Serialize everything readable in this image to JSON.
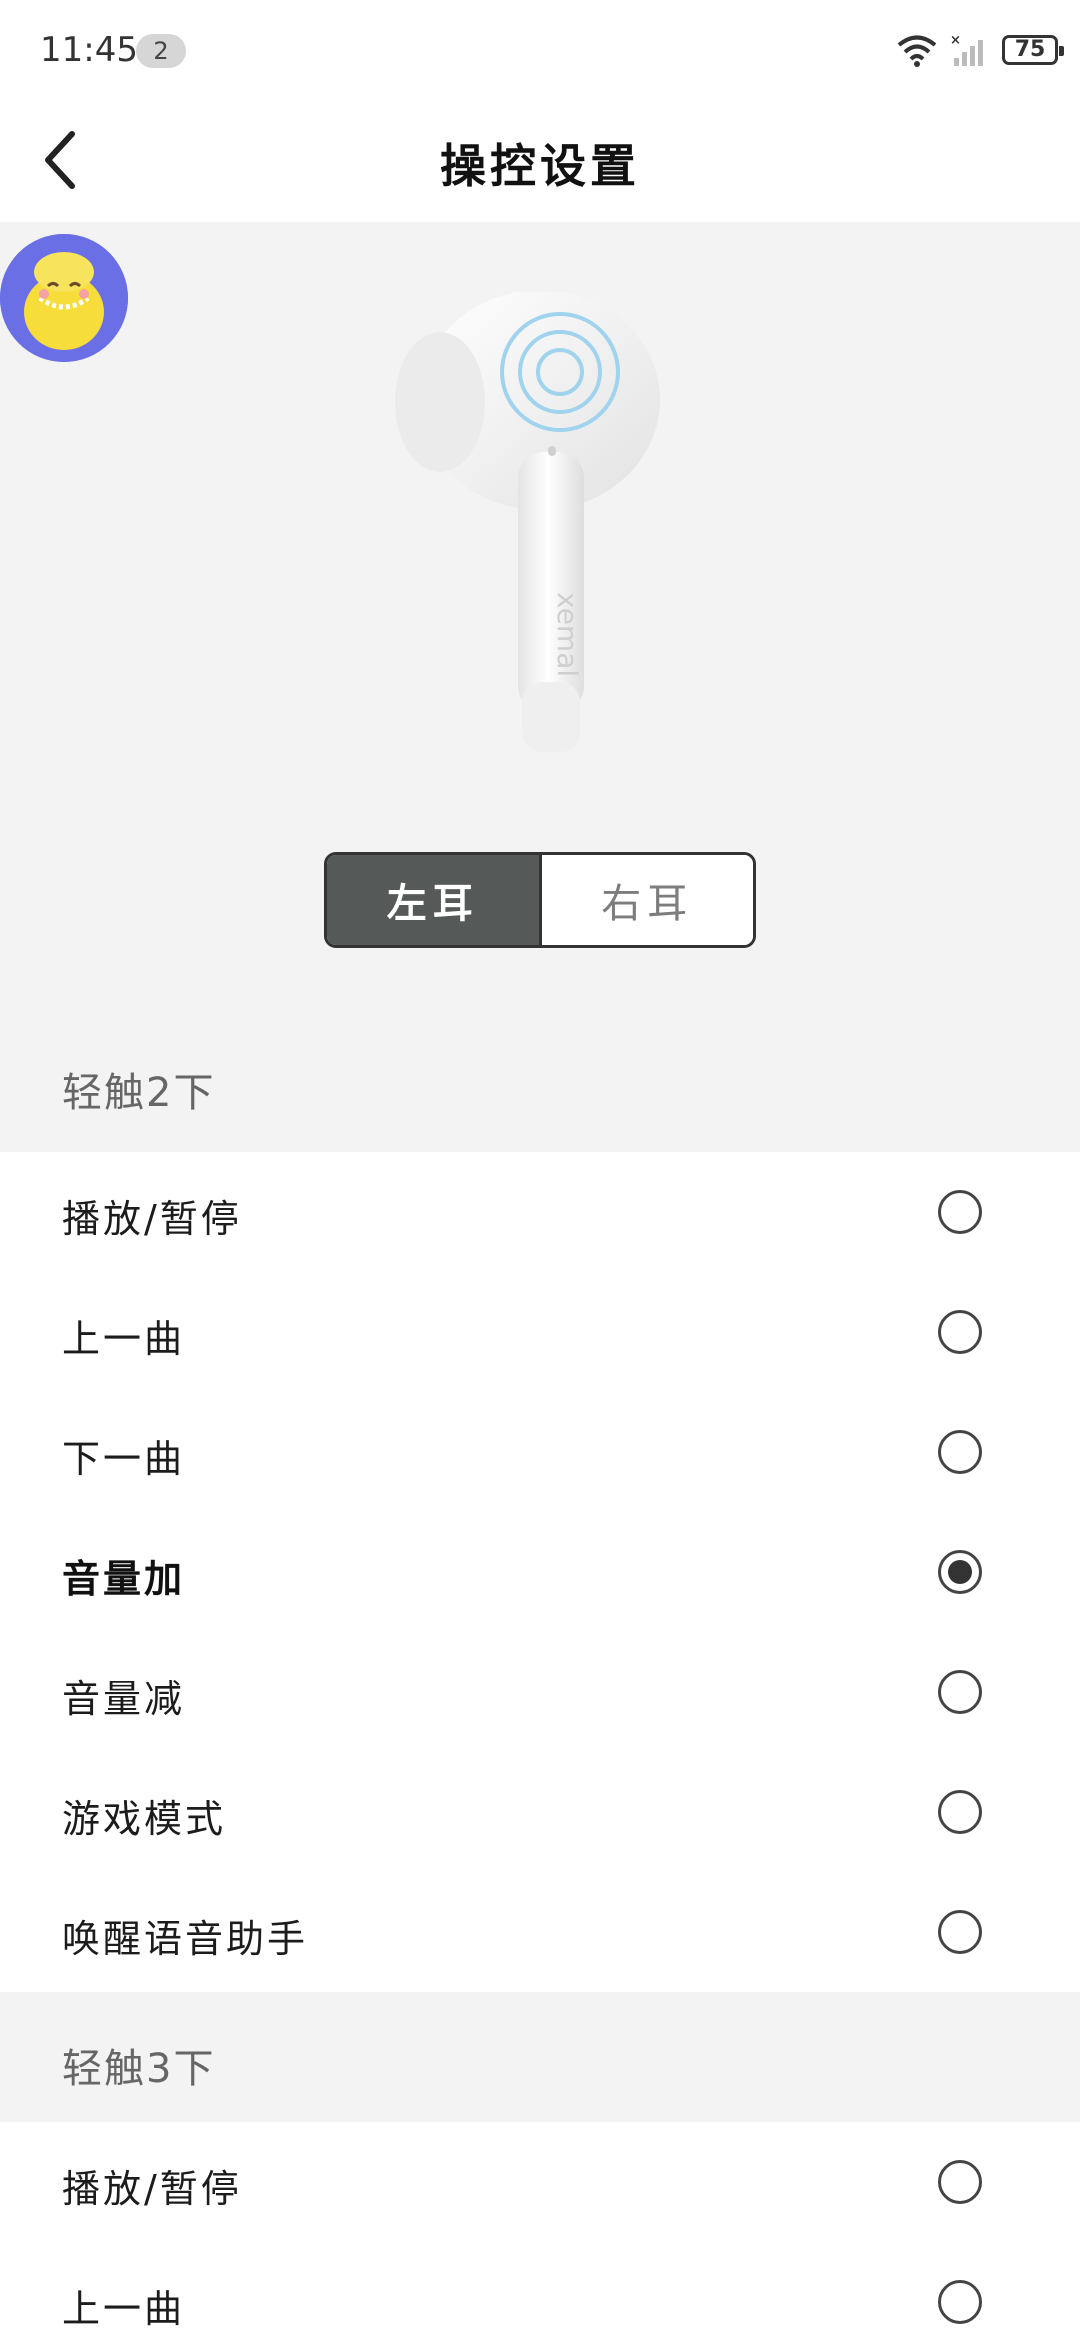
{
  "status_bar": {
    "time": "11:45",
    "notification_count": "2",
    "battery": "75"
  },
  "header": {
    "title": "操控设置"
  },
  "earbud": {
    "brand_text": "xemal"
  },
  "ear_toggle": {
    "left": "左耳",
    "right": "右耳",
    "selected": "left"
  },
  "sections": [
    {
      "title": "轻触2下",
      "options": [
        {
          "label": "播放/暂停",
          "checked": false
        },
        {
          "label": "上一曲",
          "checked": false
        },
        {
          "label": "下一曲",
          "checked": false
        },
        {
          "label": "音量加",
          "checked": true
        },
        {
          "label": "音量减",
          "checked": false
        },
        {
          "label": "游戏模式",
          "checked": false
        },
        {
          "label": "唤醒语音助手",
          "checked": false
        }
      ]
    },
    {
      "title": "轻触3下",
      "options": [
        {
          "label": "播放/暂停",
          "checked": false
        },
        {
          "label": "上一曲",
          "checked": false
        }
      ]
    }
  ],
  "colors": {
    "toggle_active_bg": "#555a59",
    "hero_bg": "#f3f3f3",
    "ripple": "#9fd3ee"
  }
}
